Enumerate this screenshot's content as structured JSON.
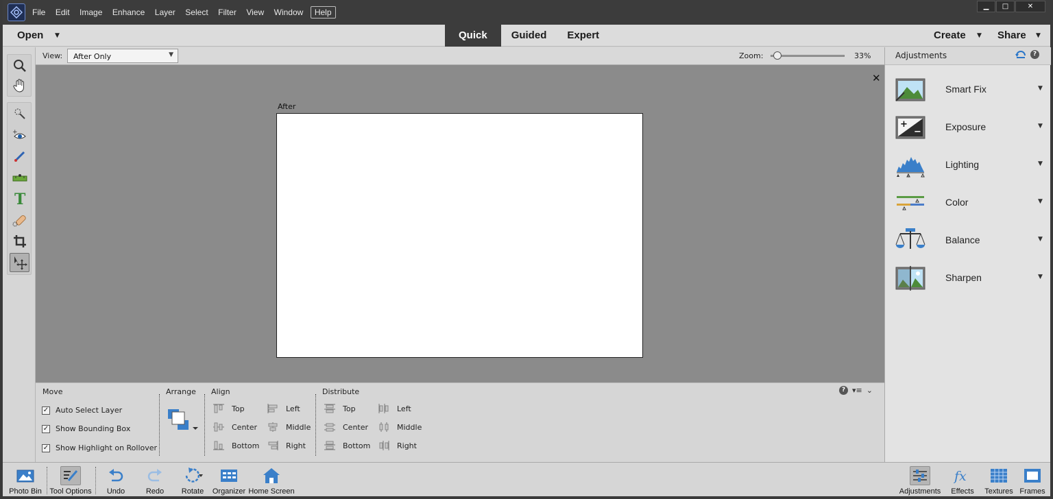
{
  "menu": {
    "items": [
      "File",
      "Edit",
      "Image",
      "Enhance",
      "Layer",
      "Select",
      "Filter",
      "View",
      "Window"
    ],
    "help": "Help"
  },
  "window_controls": {
    "minimize": "▁",
    "maximize": "□",
    "close": "✕"
  },
  "modebar": {
    "open": "Open",
    "tabs": [
      "Quick",
      "Guided",
      "Expert"
    ],
    "active_tab": "Quick",
    "create": "Create",
    "share": "Share"
  },
  "viewbar": {
    "view_label": "View:",
    "view_value": "After Only",
    "zoom_label": "Zoom:",
    "zoom_value": "33%"
  },
  "canvas": {
    "after_label": "After",
    "close_glyph": "✕"
  },
  "tools": [
    "zoom-tool",
    "hand-tool",
    "quick-selection-tool",
    "red-eye-tool",
    "whiten-teeth-tool",
    "straighten-tool",
    "type-tool",
    "spot-healing-brush-tool",
    "crop-tool",
    "move-tool"
  ],
  "selected_tool": "move-tool",
  "tool_options": {
    "move": {
      "title": "Move",
      "options": [
        {
          "label": "Auto Select Layer",
          "checked": true
        },
        {
          "label": "Show Bounding Box",
          "checked": true
        },
        {
          "label": "Show Highlight on Rollover",
          "checked": true
        }
      ]
    },
    "arrange": {
      "title": "Arrange"
    },
    "align": {
      "title": "Align",
      "col1": [
        "Top",
        "Center",
        "Bottom"
      ],
      "col2": [
        "Left",
        "Middle",
        "Right"
      ]
    },
    "distribute": {
      "title": "Distribute",
      "col1": [
        "Top",
        "Center",
        "Bottom"
      ],
      "col2": [
        "Left",
        "Middle",
        "Right"
      ]
    }
  },
  "panel": {
    "title": "Adjustments",
    "items": [
      {
        "label": "Smart Fix",
        "icon": "smart-fix-icon"
      },
      {
        "label": "Exposure",
        "icon": "exposure-icon"
      },
      {
        "label": "Lighting",
        "icon": "lighting-icon"
      },
      {
        "label": "Color",
        "icon": "color-icon"
      },
      {
        "label": "Balance",
        "icon": "balance-icon"
      },
      {
        "label": "Sharpen",
        "icon": "sharpen-icon"
      }
    ]
  },
  "bottombar": {
    "left": [
      {
        "label": "Photo Bin",
        "icon": "photo-bin-icon"
      },
      {
        "label": "Tool Options",
        "icon": "tool-options-icon"
      },
      {
        "label": "Undo",
        "icon": "undo-icon"
      },
      {
        "label": "Redo",
        "icon": "redo-icon"
      },
      {
        "label": "Rotate",
        "icon": "rotate-icon"
      },
      {
        "label": "Organizer",
        "icon": "organizer-icon"
      },
      {
        "label": "Home Screen",
        "icon": "home-screen-icon"
      }
    ],
    "right": [
      {
        "label": "Adjustments",
        "icon": "adjustments-icon"
      },
      {
        "label": "Effects",
        "icon": "effects-icon"
      },
      {
        "label": "Textures",
        "icon": "textures-icon"
      },
      {
        "label": "Frames",
        "icon": "frames-icon"
      }
    ]
  },
  "colors": {
    "accent_blue": "#3a7fc9",
    "titlebar": "#3c3c3c",
    "canvas": "#8b8b8b"
  }
}
